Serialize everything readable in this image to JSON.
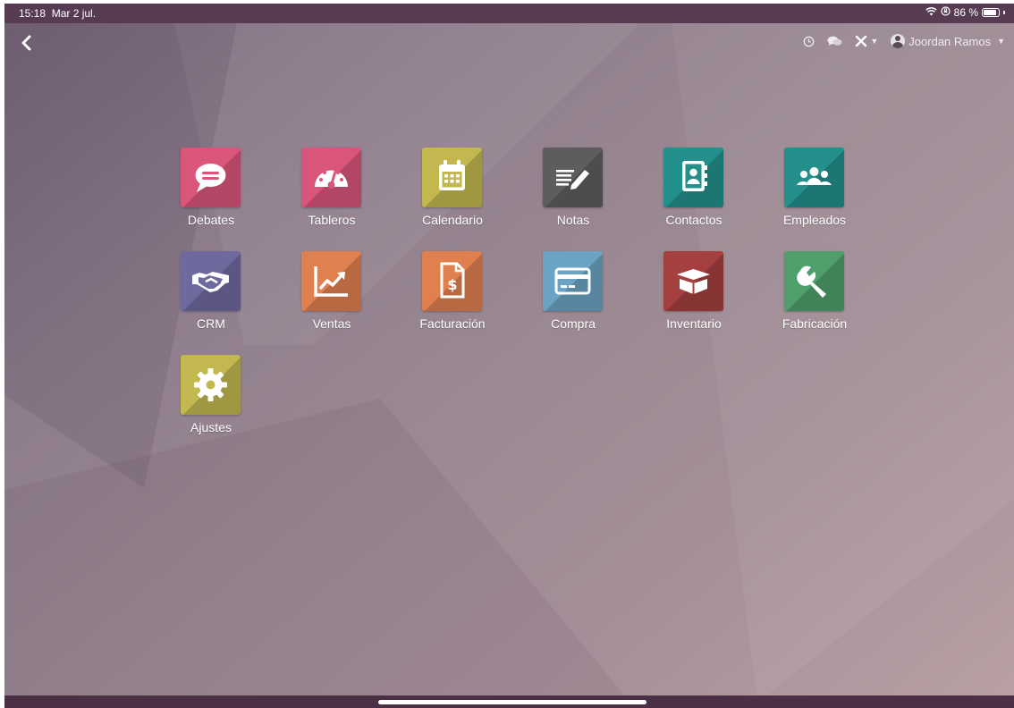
{
  "status": {
    "time": "15:18",
    "date": "Mar 2 jul.",
    "battery": "86 %",
    "battery_level": 0.86
  },
  "topbar": {
    "icons": [
      "back-icon",
      "clock-icon",
      "chat-icon",
      "tools-icon"
    ],
    "user_name": "Joordan Ramos"
  },
  "apps": [
    {
      "label": "Debates",
      "color": "#d9567a",
      "icon": "chat-bubble-icon"
    },
    {
      "label": "Tableros",
      "color": "#d9567a",
      "icon": "dashboard-gauge-icon"
    },
    {
      "label": "Calendario",
      "color": "#c2b84f",
      "icon": "calendar-icon"
    },
    {
      "label": "Notas",
      "color": "#5e5c5f",
      "icon": "notes-pencil-icon"
    },
    {
      "label": "Contactos",
      "color": "#23908b",
      "icon": "address-book-icon"
    },
    {
      "label": "Empleados",
      "color": "#23908b",
      "icon": "users-group-icon"
    },
    {
      "label": "CRM",
      "color": "#6f6a9e",
      "icon": "handshake-icon"
    },
    {
      "label": "Ventas",
      "color": "#e0804f",
      "icon": "sales-chart-icon"
    },
    {
      "label": "Facturación",
      "color": "#e0804f",
      "icon": "invoice-dollar-icon"
    },
    {
      "label": "Compra",
      "color": "#6ba3c4",
      "icon": "credit-card-icon"
    },
    {
      "label": "Inventario",
      "color": "#a4403f",
      "icon": "box-icon"
    },
    {
      "label": "Fabricación",
      "color": "#4f9f6c",
      "icon": "wrench-icon"
    },
    {
      "label": "Ajustes",
      "color": "#c2b84f",
      "icon": "gear-icon"
    }
  ]
}
